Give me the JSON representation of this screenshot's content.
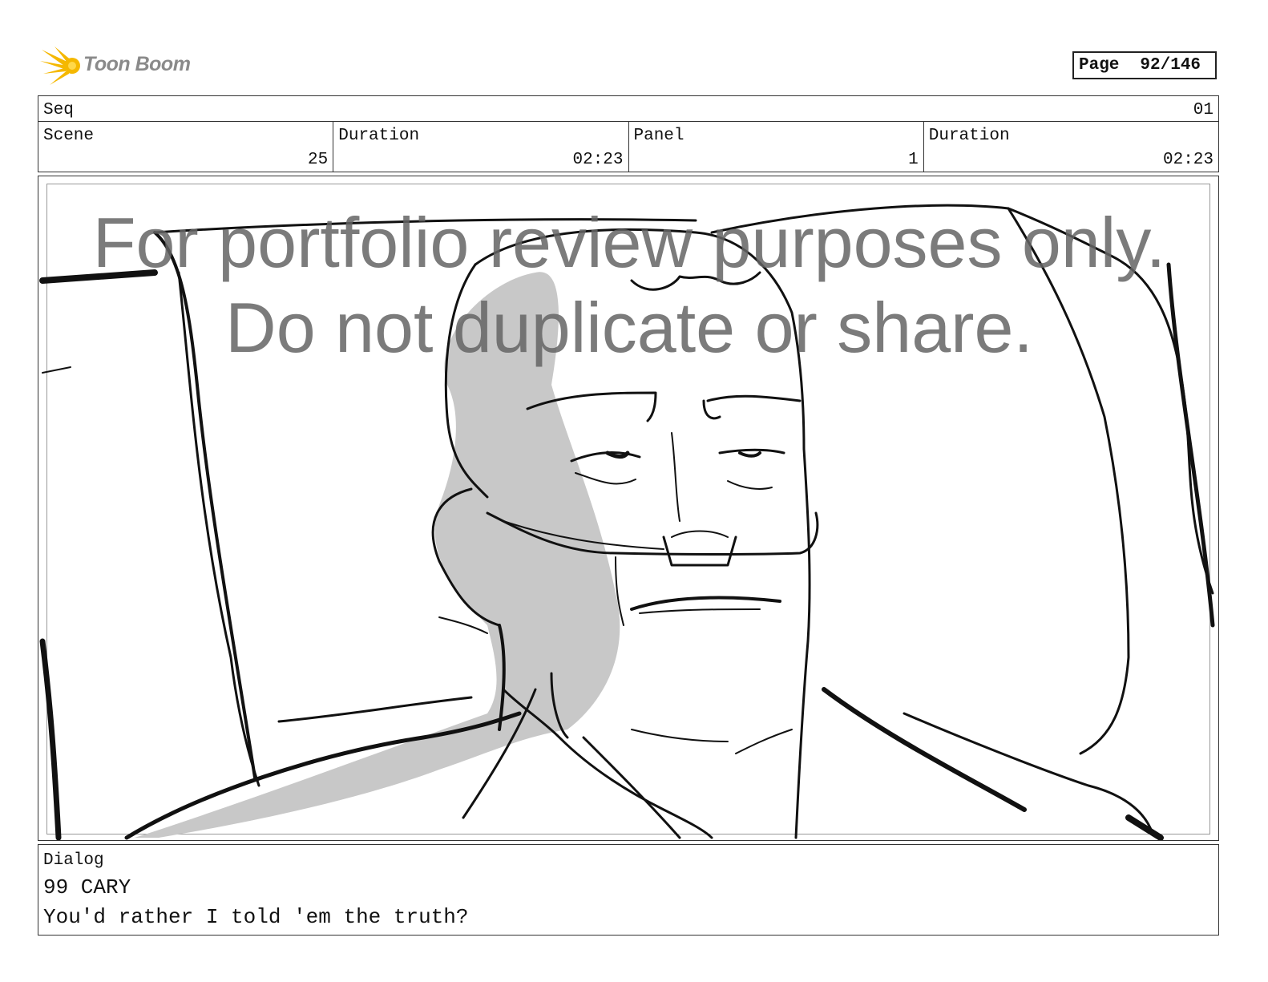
{
  "header": {
    "logo_text": "Toon Boom",
    "page_label": "Page",
    "page_value": "92/146"
  },
  "seq": {
    "label": "Seq",
    "value": "01"
  },
  "info": {
    "scene_label": "Scene",
    "scene_value": "25",
    "duration1_label": "Duration",
    "duration1_value": "02:23",
    "panel_label": "Panel",
    "panel_value": "1",
    "duration2_label": "Duration",
    "duration2_value": "02:23"
  },
  "watermark": {
    "line1": "For portfolio review purposes only.",
    "line2": "Do not duplicate or share."
  },
  "dialog": {
    "label": "Dialog",
    "line1": "99 CARY",
    "line2": "You'd rather I told 'em the truth?"
  }
}
